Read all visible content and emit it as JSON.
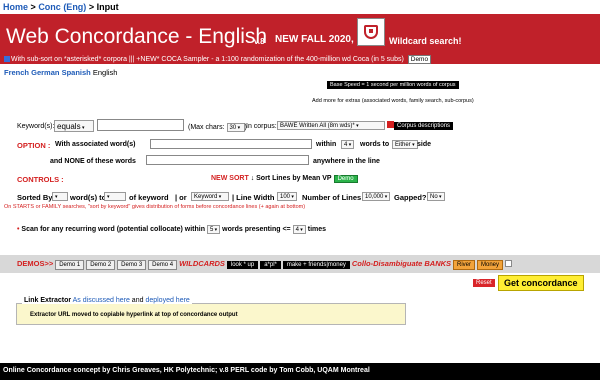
{
  "breadcrumb": {
    "home": "Home",
    "sep1": ">",
    "conc": "Conc (Eng)",
    "sep2": ">",
    "current": "Input"
  },
  "banner": {
    "title": "Web Concordance - English",
    "version": "v.8",
    "news": "NEW FALL 2020,",
    "wildcard": "Wildcard search!",
    "subline_a": "With sub-sort on ",
    "subline_asterisk": "*",
    "subline_b": "asterisked",
    "subline_c": "* corpora  |||  +NEW* COCA Sampler - a 1:100 randomization of the 400-million wd Coca (in 5 subs)",
    "demo": "Demo"
  },
  "languages": {
    "french": "French",
    "german": "German",
    "spanish": "Spanish",
    "english": "English"
  },
  "base_speed": "Base Speed = 1 second per million words of corpus",
  "more_extras": "Add more for extras (associated words, family search, sub-corpus)",
  "keywords": {
    "label": "Keyword(s):",
    "mode": "equals",
    "value": "",
    "max_label": "(Max chars:",
    "max_value": "30",
    "max_close": ")",
    "corpus_label": "In corpus:",
    "corpus_value": "BAWE Written All (8m wds)*",
    "corpus_desc": "Corpus descriptions"
  },
  "option": {
    "label": "OPTION :",
    "with_assoc": "With associated word(s)",
    "within": "within",
    "within_n": "4",
    "words_to": "words to",
    "side": "Either",
    "side_word": "side",
    "none_of": "and NONE of these words",
    "anywhere": "anywhere in the line"
  },
  "controls": {
    "label": "CONTROLS :",
    "new_sort": "NEW SORT",
    "sort_by_vp": "Sort Lines by Mean VP",
    "demo": "Demo",
    "sorted_by": "Sorted By",
    "sort_dir": "",
    "words_to": "word(s) to",
    "of_kw_sel": "",
    "of_keyword": "of keyword",
    "sep_or": "|  or",
    "keyword_sel": "Keyword",
    "line_width": "| Line Width",
    "line_width_val": "100",
    "num_lines": "Number of Lines",
    "num_lines_val": "10,000",
    "gapped": "Gapped?",
    "gapped_val": "No",
    "note": "On STARTS or FAMILY searches, \"sort by keyword\" gives distribution of forms before concordance lines (+ again at bottom)"
  },
  "scan": {
    "label": "Scan for any recurring word (potential collocate) within",
    "within_n": "5",
    "presenting": "words presenting <=",
    "times_n": "4",
    "times": "times"
  },
  "demos_bar": {
    "label": "DEMOS>>",
    "demos": [
      "Demo 1",
      "Demo 2",
      "Demo 3",
      "Demo 4"
    ],
    "wildcards_label": "WILDCARDS",
    "wildcards": [
      "look * up",
      "a*pl*",
      "make + friends|money"
    ],
    "collo_label": "Collo-Disambiguate BANKS",
    "collo": [
      "River",
      "Money"
    ]
  },
  "actions": {
    "reset": "Reset",
    "get": "Get concordance"
  },
  "extractor": {
    "title": "Link Extractor",
    "as_discussed": "As discussed here",
    "and": "and",
    "deployed": "deployed here",
    "body": "Extractor URL moved to copiable hyperlink at top of concordance output"
  },
  "footer": "Online Concordance concept by Chris Greaves, HK Polytechnic; v.8 PERL code by Tom Cobb, UQAM Montreal",
  "colors": {
    "banner": "#c0212a",
    "accent_red": "#d42020",
    "link": "#1e5bb8",
    "get_button": "#ffee33"
  }
}
